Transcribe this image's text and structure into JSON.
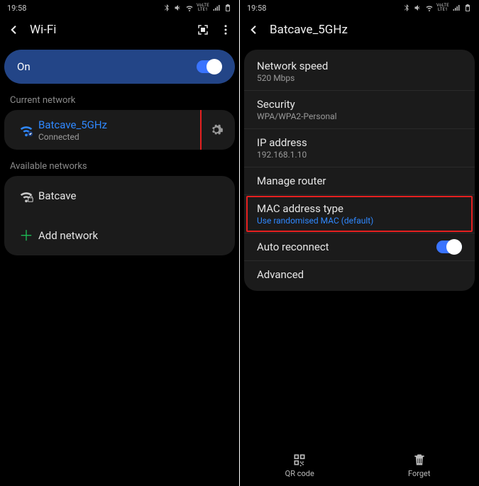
{
  "status": {
    "time": "19:58",
    "net_label": "VoLTE\nLTE1"
  },
  "left": {
    "header_title": "Wi-Fi",
    "switch_label": "On",
    "section_current": "Current network",
    "section_available": "Available networks",
    "current": {
      "ssid": "Batcave_5GHz",
      "status": "Connected"
    },
    "available": [
      {
        "ssid": "Batcave"
      }
    ],
    "add_label": "Add network"
  },
  "right": {
    "header_title": "Batcave_5GHz",
    "items": {
      "speed": {
        "k": "Network speed",
        "v": "520 Mbps"
      },
      "security": {
        "k": "Security",
        "v": "WPA/WPA2-Personal"
      },
      "ip": {
        "k": "IP address",
        "v": "192.168.1.10"
      },
      "manage": {
        "k": "Manage router"
      },
      "mac": {
        "k": "MAC address type",
        "v": "Use randomised MAC (default)"
      },
      "auto": {
        "k": "Auto reconnect"
      },
      "adv": {
        "k": "Advanced"
      }
    },
    "bottom": {
      "qr": "QR code",
      "forget": "Forget"
    }
  }
}
